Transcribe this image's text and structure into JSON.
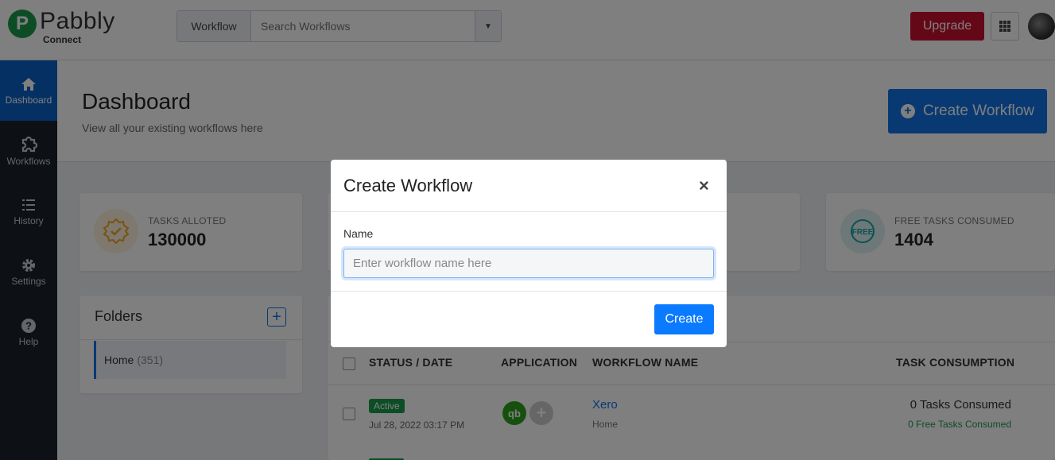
{
  "brand": {
    "mark": "P",
    "name": "Pabbly",
    "sub": "Connect"
  },
  "search": {
    "type_label": "Workflow",
    "placeholder": "Search Workflows"
  },
  "header_actions": {
    "upgrade_label": "Upgrade"
  },
  "sidebar": {
    "items": [
      {
        "label": "Dashboard",
        "icon": "home-icon"
      },
      {
        "label": "Workflows",
        "icon": "puzzle-icon"
      },
      {
        "label": "History",
        "icon": "list-icon"
      },
      {
        "label": "Settings",
        "icon": "gear-icon"
      },
      {
        "label": "Help",
        "icon": "help-icon"
      }
    ]
  },
  "page": {
    "title": "Dashboard",
    "subtitle": "View all your existing workflows here",
    "create_button": "Create Workflow"
  },
  "stats": [
    {
      "label": "TASKS ALLOTED",
      "value": "130000",
      "icon": "badge-check-icon",
      "color": "#f2a623"
    },
    {
      "label": "FREE TASKS CONSUMED",
      "value": "1404",
      "icon": "free-icon",
      "color": "#1aa2a8"
    }
  ],
  "folders": {
    "title": "Folders",
    "items": [
      {
        "name": "Home",
        "count": "(351)"
      }
    ]
  },
  "table": {
    "headers": {
      "status": "STATUS / DATE",
      "application": "APPLICATION",
      "name": "WORKFLOW NAME",
      "tasks": "TASK CONSUMPTION"
    },
    "rows": [
      {
        "status": "Active",
        "date": "Jul 28, 2022 03:17 PM",
        "app_icon": "qb",
        "name": "Xero",
        "folder": "Home",
        "tasks": "0 Tasks Consumed",
        "free_tasks": "0 Free Tasks Consumed"
      }
    ]
  },
  "modal": {
    "title": "Create Workflow",
    "close": "×",
    "field_label": "Name",
    "placeholder": "Enter workflow name here",
    "submit": "Create"
  },
  "colors": {
    "primary": "#1172e6",
    "success": "#1b9b4b",
    "danger": "#c8102e",
    "sidebar": "#1b2029"
  }
}
